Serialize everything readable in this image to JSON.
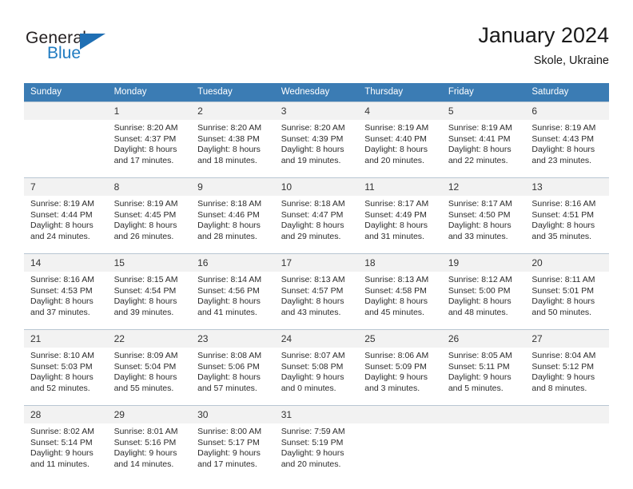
{
  "brand": {
    "word_one": "General",
    "word_two": "Blue",
    "triangle_color": "#1f6fb4",
    "blue_color": "#1f7bc1"
  },
  "header": {
    "title": "January 2024",
    "subtitle": "Skole, Ukraine"
  },
  "theme": {
    "header_bg": "#3b7cb4",
    "header_text": "#ffffff",
    "daynum_bg": "#f2f2f2",
    "grid_line": "#b9c6d2",
    "body_text": "#2b2b2b"
  },
  "weekdays": [
    "Sunday",
    "Monday",
    "Tuesday",
    "Wednesday",
    "Thursday",
    "Friday",
    "Saturday"
  ],
  "weeks": [
    [
      {
        "day": "",
        "lines": []
      },
      {
        "day": "1",
        "lines": [
          "Sunrise: 8:20 AM",
          "Sunset: 4:37 PM",
          "Daylight: 8 hours",
          "and 17 minutes."
        ]
      },
      {
        "day": "2",
        "lines": [
          "Sunrise: 8:20 AM",
          "Sunset: 4:38 PM",
          "Daylight: 8 hours",
          "and 18 minutes."
        ]
      },
      {
        "day": "3",
        "lines": [
          "Sunrise: 8:20 AM",
          "Sunset: 4:39 PM",
          "Daylight: 8 hours",
          "and 19 minutes."
        ]
      },
      {
        "day": "4",
        "lines": [
          "Sunrise: 8:19 AM",
          "Sunset: 4:40 PM",
          "Daylight: 8 hours",
          "and 20 minutes."
        ]
      },
      {
        "day": "5",
        "lines": [
          "Sunrise: 8:19 AM",
          "Sunset: 4:41 PM",
          "Daylight: 8 hours",
          "and 22 minutes."
        ]
      },
      {
        "day": "6",
        "lines": [
          "Sunrise: 8:19 AM",
          "Sunset: 4:43 PM",
          "Daylight: 8 hours",
          "and 23 minutes."
        ]
      }
    ],
    [
      {
        "day": "7",
        "lines": [
          "Sunrise: 8:19 AM",
          "Sunset: 4:44 PM",
          "Daylight: 8 hours",
          "and 24 minutes."
        ]
      },
      {
        "day": "8",
        "lines": [
          "Sunrise: 8:19 AM",
          "Sunset: 4:45 PM",
          "Daylight: 8 hours",
          "and 26 minutes."
        ]
      },
      {
        "day": "9",
        "lines": [
          "Sunrise: 8:18 AM",
          "Sunset: 4:46 PM",
          "Daylight: 8 hours",
          "and 28 minutes."
        ]
      },
      {
        "day": "10",
        "lines": [
          "Sunrise: 8:18 AM",
          "Sunset: 4:47 PM",
          "Daylight: 8 hours",
          "and 29 minutes."
        ]
      },
      {
        "day": "11",
        "lines": [
          "Sunrise: 8:17 AM",
          "Sunset: 4:49 PM",
          "Daylight: 8 hours",
          "and 31 minutes."
        ]
      },
      {
        "day": "12",
        "lines": [
          "Sunrise: 8:17 AM",
          "Sunset: 4:50 PM",
          "Daylight: 8 hours",
          "and 33 minutes."
        ]
      },
      {
        "day": "13",
        "lines": [
          "Sunrise: 8:16 AM",
          "Sunset: 4:51 PM",
          "Daylight: 8 hours",
          "and 35 minutes."
        ]
      }
    ],
    [
      {
        "day": "14",
        "lines": [
          "Sunrise: 8:16 AM",
          "Sunset: 4:53 PM",
          "Daylight: 8 hours",
          "and 37 minutes."
        ]
      },
      {
        "day": "15",
        "lines": [
          "Sunrise: 8:15 AM",
          "Sunset: 4:54 PM",
          "Daylight: 8 hours",
          "and 39 minutes."
        ]
      },
      {
        "day": "16",
        "lines": [
          "Sunrise: 8:14 AM",
          "Sunset: 4:56 PM",
          "Daylight: 8 hours",
          "and 41 minutes."
        ]
      },
      {
        "day": "17",
        "lines": [
          "Sunrise: 8:13 AM",
          "Sunset: 4:57 PM",
          "Daylight: 8 hours",
          "and 43 minutes."
        ]
      },
      {
        "day": "18",
        "lines": [
          "Sunrise: 8:13 AM",
          "Sunset: 4:58 PM",
          "Daylight: 8 hours",
          "and 45 minutes."
        ]
      },
      {
        "day": "19",
        "lines": [
          "Sunrise: 8:12 AM",
          "Sunset: 5:00 PM",
          "Daylight: 8 hours",
          "and 48 minutes."
        ]
      },
      {
        "day": "20",
        "lines": [
          "Sunrise: 8:11 AM",
          "Sunset: 5:01 PM",
          "Daylight: 8 hours",
          "and 50 minutes."
        ]
      }
    ],
    [
      {
        "day": "21",
        "lines": [
          "Sunrise: 8:10 AM",
          "Sunset: 5:03 PM",
          "Daylight: 8 hours",
          "and 52 minutes."
        ]
      },
      {
        "day": "22",
        "lines": [
          "Sunrise: 8:09 AM",
          "Sunset: 5:04 PM",
          "Daylight: 8 hours",
          "and 55 minutes."
        ]
      },
      {
        "day": "23",
        "lines": [
          "Sunrise: 8:08 AM",
          "Sunset: 5:06 PM",
          "Daylight: 8 hours",
          "and 57 minutes."
        ]
      },
      {
        "day": "24",
        "lines": [
          "Sunrise: 8:07 AM",
          "Sunset: 5:08 PM",
          "Daylight: 9 hours",
          "and 0 minutes."
        ]
      },
      {
        "day": "25",
        "lines": [
          "Sunrise: 8:06 AM",
          "Sunset: 5:09 PM",
          "Daylight: 9 hours",
          "and 3 minutes."
        ]
      },
      {
        "day": "26",
        "lines": [
          "Sunrise: 8:05 AM",
          "Sunset: 5:11 PM",
          "Daylight: 9 hours",
          "and 5 minutes."
        ]
      },
      {
        "day": "27",
        "lines": [
          "Sunrise: 8:04 AM",
          "Sunset: 5:12 PM",
          "Daylight: 9 hours",
          "and 8 minutes."
        ]
      }
    ],
    [
      {
        "day": "28",
        "lines": [
          "Sunrise: 8:02 AM",
          "Sunset: 5:14 PM",
          "Daylight: 9 hours",
          "and 11 minutes."
        ]
      },
      {
        "day": "29",
        "lines": [
          "Sunrise: 8:01 AM",
          "Sunset: 5:16 PM",
          "Daylight: 9 hours",
          "and 14 minutes."
        ]
      },
      {
        "day": "30",
        "lines": [
          "Sunrise: 8:00 AM",
          "Sunset: 5:17 PM",
          "Daylight: 9 hours",
          "and 17 minutes."
        ]
      },
      {
        "day": "31",
        "lines": [
          "Sunrise: 7:59 AM",
          "Sunset: 5:19 PM",
          "Daylight: 9 hours",
          "and 20 minutes."
        ]
      },
      {
        "day": "",
        "lines": []
      },
      {
        "day": "",
        "lines": []
      },
      {
        "day": "",
        "lines": []
      }
    ]
  ]
}
